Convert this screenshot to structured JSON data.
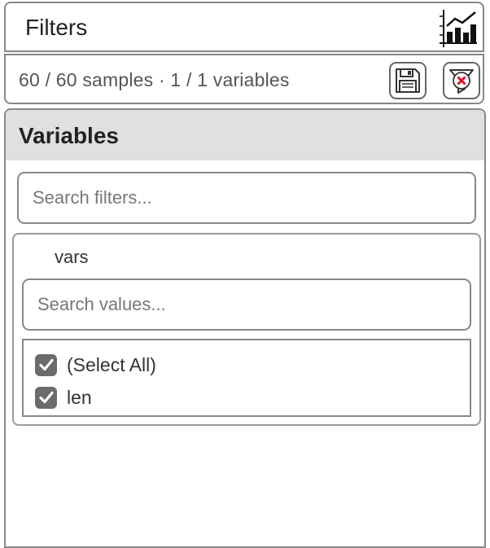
{
  "header": {
    "title": "Filters",
    "chart_icon": "bar-chart-icon"
  },
  "summary": {
    "text": "60 / 60 samples · 1 / 1 variables",
    "save_icon": "floppy-disk-icon",
    "clear_icon": "filter-clear-icon"
  },
  "panel": {
    "title": "Variables",
    "search_placeholder": "Search filters...",
    "search_value": ""
  },
  "variable_card": {
    "name": "vars",
    "search_placeholder": "Search values...",
    "search_value": "",
    "options": [
      {
        "label": "(Select All)",
        "checked": true
      },
      {
        "label": "len",
        "checked": true
      }
    ]
  },
  "colors": {
    "border": "#888888",
    "panel_header_bg": "#e0e0e0",
    "checkbox_fill": "#6b6b6b",
    "clear_x": "#e0141e"
  }
}
